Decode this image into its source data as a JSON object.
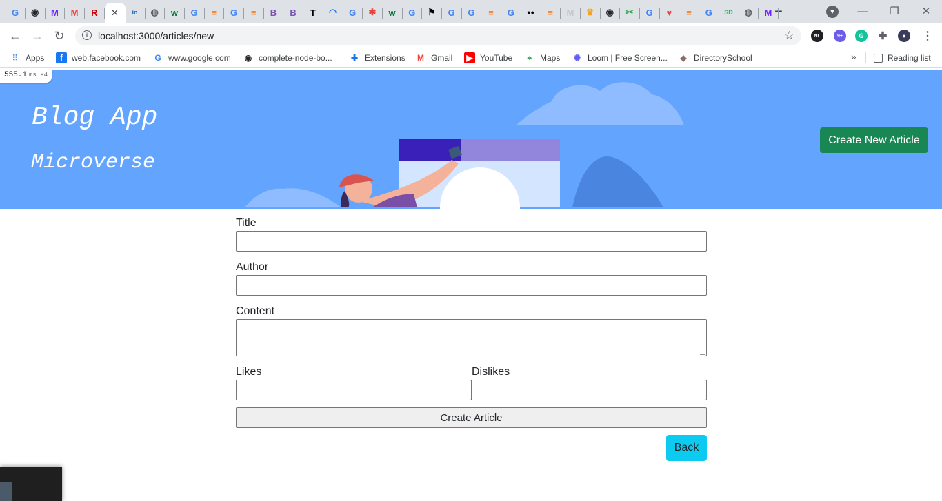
{
  "browser": {
    "tabs": [
      {
        "icon": "google-icon",
        "glyph": "G",
        "color": "#4285f4"
      },
      {
        "icon": "github-icon",
        "glyph": "◉",
        "color": "#24292e"
      },
      {
        "icon": "microverse-icon",
        "glyph": "M",
        "color": "#6f23ff"
      },
      {
        "icon": "gmail-icon",
        "glyph": "M",
        "color": "#ea4335"
      },
      {
        "icon": "rails-icon",
        "glyph": "R",
        "color": "#cc0000"
      },
      {
        "icon": "linkedin-icon",
        "glyph": "in",
        "color": "#0a66c2"
      },
      {
        "icon": "globe-icon",
        "glyph": "◍",
        "color": "#5f6368"
      },
      {
        "icon": "wix-icon",
        "glyph": "w",
        "color": "#0a7a3b"
      },
      {
        "icon": "google-icon",
        "glyph": "G",
        "color": "#4285f4"
      },
      {
        "icon": "stackoverflow-icon",
        "glyph": "≡",
        "color": "#f48024"
      },
      {
        "icon": "google-icon",
        "glyph": "G",
        "color": "#4285f4"
      },
      {
        "icon": "stackoverflow-icon",
        "glyph": "≡",
        "color": "#f48024"
      },
      {
        "icon": "bootstrap-icon",
        "glyph": "B",
        "color": "#7952b3"
      },
      {
        "icon": "bootstrap-icon",
        "glyph": "B",
        "color": "#7952b3"
      },
      {
        "icon": "nytimes-icon",
        "glyph": "T",
        "color": "#000000"
      },
      {
        "icon": "wifi-icon",
        "glyph": "◠",
        "color": "#1a73e8"
      },
      {
        "icon": "google-icon",
        "glyph": "G",
        "color": "#4285f4"
      },
      {
        "icon": "asterisk-icon",
        "glyph": "✱",
        "color": "#e8453c"
      },
      {
        "icon": "wix-icon",
        "glyph": "w",
        "color": "#0a7a3b"
      },
      {
        "icon": "google-icon",
        "glyph": "G",
        "color": "#4285f4"
      },
      {
        "icon": "flag-icon",
        "glyph": "⚑",
        "color": "#000000"
      },
      {
        "icon": "google-icon",
        "glyph": "G",
        "color": "#4285f4"
      },
      {
        "icon": "google-icon",
        "glyph": "G",
        "color": "#4285f4"
      },
      {
        "icon": "stackoverflow-icon",
        "glyph": "≡",
        "color": "#f48024"
      },
      {
        "icon": "google-icon",
        "glyph": "G",
        "color": "#4285f4"
      },
      {
        "icon": "medium-icon",
        "glyph": "●●",
        "color": "#000000"
      },
      {
        "icon": "stackoverflow-icon",
        "glyph": "≡",
        "color": "#f48024"
      },
      {
        "icon": "microverse-icon",
        "glyph": "M",
        "color": "#c7c7c7"
      },
      {
        "icon": "crown-icon",
        "glyph": "♛",
        "color": "#f4a020"
      },
      {
        "icon": "github-icon",
        "glyph": "◉",
        "color": "#24292e"
      },
      {
        "icon": "scissors-icon",
        "glyph": "✂",
        "color": "#34a853"
      },
      {
        "icon": "google-icon",
        "glyph": "G",
        "color": "#4285f4"
      },
      {
        "icon": "heart-icon",
        "glyph": "♥",
        "color": "#e8453c"
      },
      {
        "icon": "stackoverflow-icon",
        "glyph": "≡",
        "color": "#f48024"
      },
      {
        "icon": "google-icon",
        "glyph": "G",
        "color": "#4285f4"
      },
      {
        "icon": "sd-icon",
        "glyph": "SD",
        "color": "#1db954"
      },
      {
        "icon": "globe-icon",
        "glyph": "◍",
        "color": "#5f6368"
      },
      {
        "icon": "microverse-icon",
        "glyph": "M",
        "color": "#6f23ff"
      }
    ],
    "active_tab_close": "✕",
    "new_tab": "+",
    "window_controls": {
      "minimize": "—",
      "restore": "❐",
      "close": "✕"
    },
    "url": "localhost:3000/articles/new",
    "extensions": {
      "nl_badge": "NL",
      "badge_count": "9+",
      "grammarly": "G"
    },
    "bookmarks": [
      {
        "label": "Apps",
        "icon": "apps-grid-icon"
      },
      {
        "label": "web.facebook.com",
        "icon": "facebook-icon"
      },
      {
        "label": "www.google.com",
        "icon": "google-icon"
      },
      {
        "label": "complete-node-bo...",
        "icon": "github-icon"
      },
      {
        "label": "Extensions",
        "icon": "puzzle-icon"
      },
      {
        "label": "Gmail",
        "icon": "gmail-icon"
      },
      {
        "label": "YouTube",
        "icon": "youtube-icon"
      },
      {
        "label": "Maps",
        "icon": "maps-icon"
      },
      {
        "label": "Loom | Free Screen...",
        "icon": "loom-icon"
      },
      {
        "label": "DirectorySchool",
        "icon": "directory-icon"
      }
    ],
    "bookmarks_more": "»",
    "reading_list": "Reading list"
  },
  "perf": {
    "value": "555.1",
    "unit": "ms ×4"
  },
  "hero": {
    "title": "Blog App",
    "subtitle": "Microverse",
    "button": "Create New Article"
  },
  "form": {
    "title_label": "Title",
    "author_label": "Author",
    "content_label": "Content",
    "likes_label": "Likes",
    "dislikes_label": "Dislikes",
    "submit": "Create Article",
    "back": "Back"
  }
}
